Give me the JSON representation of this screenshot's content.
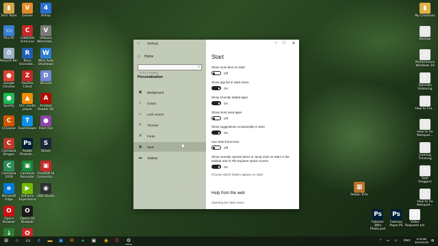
{
  "desktop_left": [
    {
      "label": "Tech Team",
      "color": "#d4a64a",
      "glyph": "▮"
    },
    {
      "label": "Games",
      "color": "#e38a2a",
      "glyph": "V"
    },
    {
      "label": "Ashep",
      "color": "#2a6fd4",
      "glyph": "4"
    },
    {
      "label": "This PC",
      "color": "#3b7fd4",
      "glyph": "▭"
    },
    {
      "label": "COMODO Antivirus",
      "color": "#c62828",
      "glyph": "C"
    },
    {
      "label": "VMware Workstati...",
      "color": "#7a7a7a",
      "glyph": "V"
    },
    {
      "label": "Recycle Bin",
      "color": "#9bb0c6",
      "glyph": "♻"
    },
    {
      "label": "Revo Uninstall...",
      "color": "#1f5fb5",
      "glyph": "R"
    },
    {
      "label": "Wise Auto Shutdown",
      "color": "#2e7dd1",
      "glyph": "W"
    },
    {
      "label": "Google Chrome",
      "color": "#db4437",
      "glyph": "●"
    },
    {
      "label": "FileZilla Client",
      "color": "#c62828",
      "glyph": "Z"
    },
    {
      "label": "Discord",
      "color": "#7289da",
      "glyph": "D"
    },
    {
      "label": "Spotify",
      "color": "#1db954",
      "glyph": "●"
    },
    {
      "label": "VLC media player",
      "color": "#f28c00",
      "glyph": "▲"
    },
    {
      "label": "Acrobat Reader DC",
      "color": "#b30b00",
      "glyph": "A"
    },
    {
      "label": "CCleaner",
      "color": "#d35400",
      "glyph": "C"
    },
    {
      "label": "TeamViewer",
      "color": "#0e8ee9",
      "glyph": "T"
    },
    {
      "label": "Paint Dot",
      "color": "#8e44ad",
      "glyph": "●"
    },
    {
      "label": "Camtasia Dragon",
      "color": "#c0392b",
      "glyph": "C"
    },
    {
      "label": "Adobe Photosh...",
      "color": "#001e36",
      "glyph": "Ps"
    },
    {
      "label": "Steam",
      "color": "#1b2838",
      "glyph": "S"
    },
    {
      "label": "Camtasia 2018",
      "color": "#2e8b57",
      "glyph": "C"
    },
    {
      "label": "Camtasia Recorder",
      "color": "#1a8a3a",
      "glyph": "▣"
    },
    {
      "label": "FreeRDP UI Connectio...",
      "color": "#c62828",
      "glyph": "▣"
    },
    {
      "label": "Microsoft Edge",
      "color": "#0078d7",
      "glyph": "e"
    },
    {
      "label": "GeForce Experience",
      "color": "#76b900",
      "glyph": "▶"
    },
    {
      "label": "OBS Studio",
      "color": "#302e31",
      "glyph": "◉"
    },
    {
      "label": "Opera Browser",
      "color": "#cc0f16",
      "glyph": "O"
    },
    {
      "label": "Opera GX Browser",
      "color": "#1a1a1a",
      "glyph": "O"
    },
    {
      "label": "",
      "color": "transparent",
      "glyph": ""
    },
    {
      "label": "Internet Downlo...",
      "color": "#2e7d32",
      "glyph": "↓"
    },
    {
      "label": "Opera GX Browser",
      "color": "#c62828",
      "glyph": "O"
    }
  ],
  "desktop_right": [
    {
      "label": "My Creations",
      "color": "#e0b34a",
      "glyph": "▮"
    },
    {
      "label": "Backup",
      "color": "#e9e9e9",
      "glyph": "▯"
    },
    {
      "label": "Performance Windows 10",
      "color": "#e9e9e9",
      "glyph": "▯"
    },
    {
      "label": "Tailsmith Unboxing",
      "color": "#e9e9e9",
      "glyph": "▯"
    },
    {
      "label": "How to Cre...",
      "color": "#e9e9e9",
      "glyph": "▯"
    },
    {
      "label": "How to Fix Notepad...",
      "color": "#e9e9e9",
      "glyph": "▯"
    },
    {
      "label": "Gaming Thinking",
      "color": "#e9e9e9",
      "glyph": "▯"
    },
    {
      "label": "Sam Vloggers",
      "color": "#e9e9e9",
      "glyph": "▯"
    },
    {
      "label": "How to Fix Notepad...",
      "color": "#e9e9e9",
      "glyph": "▯"
    }
  ],
  "desktop_bottom_right": [
    {
      "label": "Pedals Trifo",
      "color": "#b8732a",
      "glyph": "▦"
    },
    {
      "label": "Fatmain 3Min Photo.psd",
      "color": "#001e36",
      "glyph": "Ps"
    },
    {
      "label": "Fatmain Paper.PS",
      "color": "#001e36",
      "glyph": "Ps"
    },
    {
      "label": "Video Requests.txt",
      "color": "#f0f0f0",
      "glyph": "≡"
    }
  ],
  "window": {
    "title": "Settings",
    "home_label": "Home",
    "search_placeholder": "Find a setting",
    "section": "Personalization",
    "nav": [
      {
        "label": "Background",
        "icon": "▣",
        "icon_name": "background-icon"
      },
      {
        "label": "Colors",
        "icon": "◐",
        "icon_name": "colors-icon"
      },
      {
        "label": "Lock screen",
        "icon": "▭",
        "icon_name": "lock-screen-icon"
      },
      {
        "label": "Themes",
        "icon": "✎",
        "icon_name": "themes-icon"
      },
      {
        "label": "Fonts",
        "icon": "A",
        "icon_name": "fonts-icon"
      },
      {
        "label": "Start",
        "icon": "▦",
        "icon_name": "start-icon",
        "selected": true
      },
      {
        "label": "Taskbar",
        "icon": "▬",
        "icon_name": "taskbar-icon"
      }
    ]
  },
  "content": {
    "title": "Start",
    "options": [
      {
        "label": "Show more tiles on Start",
        "state": "Off",
        "on": false
      },
      {
        "label": "Show app list in Start menu",
        "state": "On",
        "on": true
      },
      {
        "label": "Show recently added apps",
        "state": "On",
        "on": true
      },
      {
        "label": "Show most used apps",
        "state": "Off",
        "on": false
      },
      {
        "label": "Show suggestions occasionally in Start",
        "state": "On",
        "on": true
      },
      {
        "label": "Use Start full screen",
        "state": "Off",
        "on": false
      },
      {
        "label": "Show recently opened items in Jump Lists on Start or the taskbar and in File Explorer Quick Access",
        "state": "On",
        "on": true
      }
    ],
    "folders_link": "Choose which folders appear on Start",
    "web_heading": "Help from the web",
    "web_link": "Opening the Start menu"
  },
  "taskbar": {
    "lang": "ENG",
    "time": "8:18 AM",
    "date": "30/10/2020"
  }
}
